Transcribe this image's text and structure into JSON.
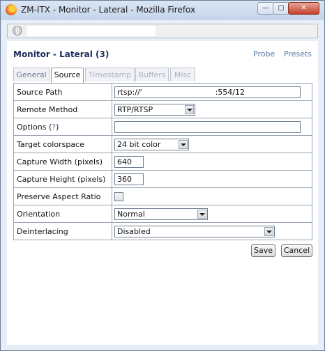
{
  "window": {
    "title": "ZM-ITX - Monitor - Lateral - Mozilla Firefox",
    "min_glyph": "—",
    "max_glyph": "▢",
    "close_glyph": "✕"
  },
  "urlbar": {
    "value": ""
  },
  "page": {
    "title": "Monitor - Lateral (3)",
    "probe_label": "Probe",
    "presets_label": "Presets"
  },
  "tabs": [
    {
      "label": "General",
      "active": false
    },
    {
      "label": "Source",
      "active": true
    },
    {
      "label": "Timestamp",
      "active": false
    },
    {
      "label": "Buffers",
      "active": false
    },
    {
      "label": "Misc",
      "active": false
    }
  ],
  "form": {
    "source_path": {
      "label": "Source Path",
      "value": "rtsp://'                              :554/12"
    },
    "remote_method": {
      "label": "Remote Method",
      "value": "RTP/RTSP"
    },
    "options": {
      "label": "Options (",
      "help": "?",
      "label_end": ")",
      "value": ""
    },
    "target_colorspace": {
      "label": "Target colorspace",
      "value": "24 bit color"
    },
    "capture_width": {
      "label": "Capture Width (pixels)",
      "value": "640"
    },
    "capture_height": {
      "label": "Capture Height (pixels)",
      "value": "360"
    },
    "preserve_aspect": {
      "label": "Preserve Aspect Ratio",
      "checked": false
    },
    "orientation": {
      "label": "Orientation",
      "value": "Normal"
    },
    "deinterlacing": {
      "label": "Deinterlacing",
      "value": "Disabled"
    }
  },
  "buttons": {
    "save": "Save",
    "cancel": "Cancel"
  },
  "colors": {
    "title_text": "#1b2b5c",
    "link": "#5577aa",
    "window_frame": "#c4d4ea",
    "close_button": "#c4412a"
  }
}
